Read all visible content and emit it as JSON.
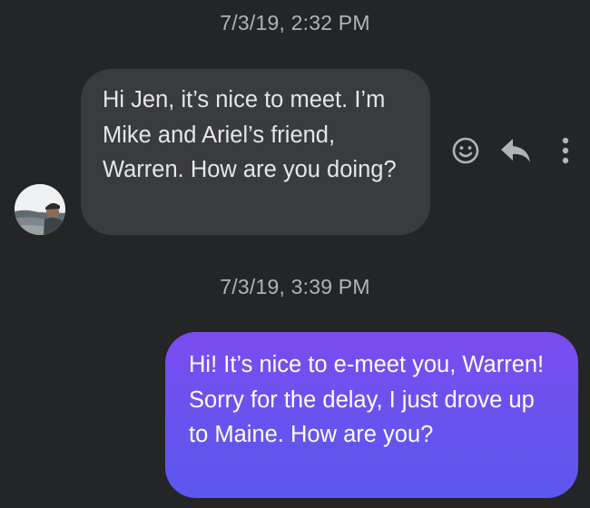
{
  "thread": {
    "messages": [
      {
        "timestamp": "7/3/19, 2:32 PM",
        "direction": "incoming",
        "text": "Hi Jen, it’s nice to meet. I’m Mike and Ariel’s friend, Warren. How are you doing?"
      },
      {
        "timestamp": "7/3/19, 3:39 PM",
        "direction": "outgoing",
        "text": "Hi! It’s nice to e-meet you, Warren! Sorry for the delay, I just drove up to Maine. How are you?"
      }
    ]
  },
  "message_actions": {
    "icons": [
      "smiley-face-icon",
      "reply-arrow-icon",
      "more-options-icon"
    ]
  },
  "colors": {
    "background": "#242526",
    "incoming_bubble": "#3a3b3c",
    "outgoing_gradient_top": "#7b4cf0",
    "outgoing_gradient_bottom": "#5a58ee",
    "timestamp_text": "#b0b3b8"
  }
}
